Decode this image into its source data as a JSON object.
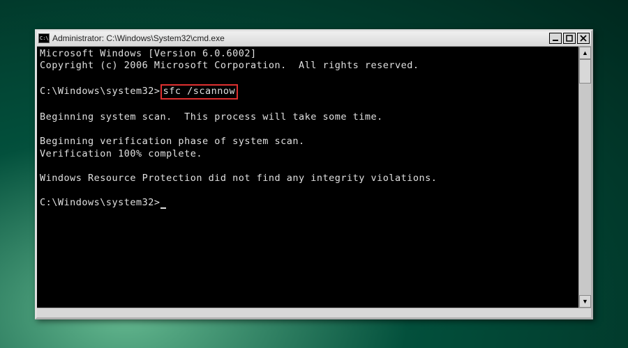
{
  "titlebar": {
    "icon_text": "C:\\",
    "title": "Administrator: C:\\Windows\\System32\\cmd.exe"
  },
  "window_controls": {
    "minimize": "_",
    "maximize": "□",
    "close": "✕"
  },
  "terminal": {
    "line1": "Microsoft Windows [Version 6.0.6002]",
    "line2": "Copyright (c) 2006 Microsoft Corporation.  All rights reserved.",
    "prompt1_path": "C:\\Windows\\system32>",
    "command": "sfc /scannow",
    "line4": "Beginning system scan.  This process will take some time.",
    "line5": "Beginning verification phase of system scan.",
    "line6": "Verification 100% complete.",
    "line7": "Windows Resource Protection did not find any integrity violations.",
    "prompt2_path": "C:\\Windows\\system32>"
  },
  "scrollbar": {
    "up": "▲",
    "down": "▼"
  }
}
